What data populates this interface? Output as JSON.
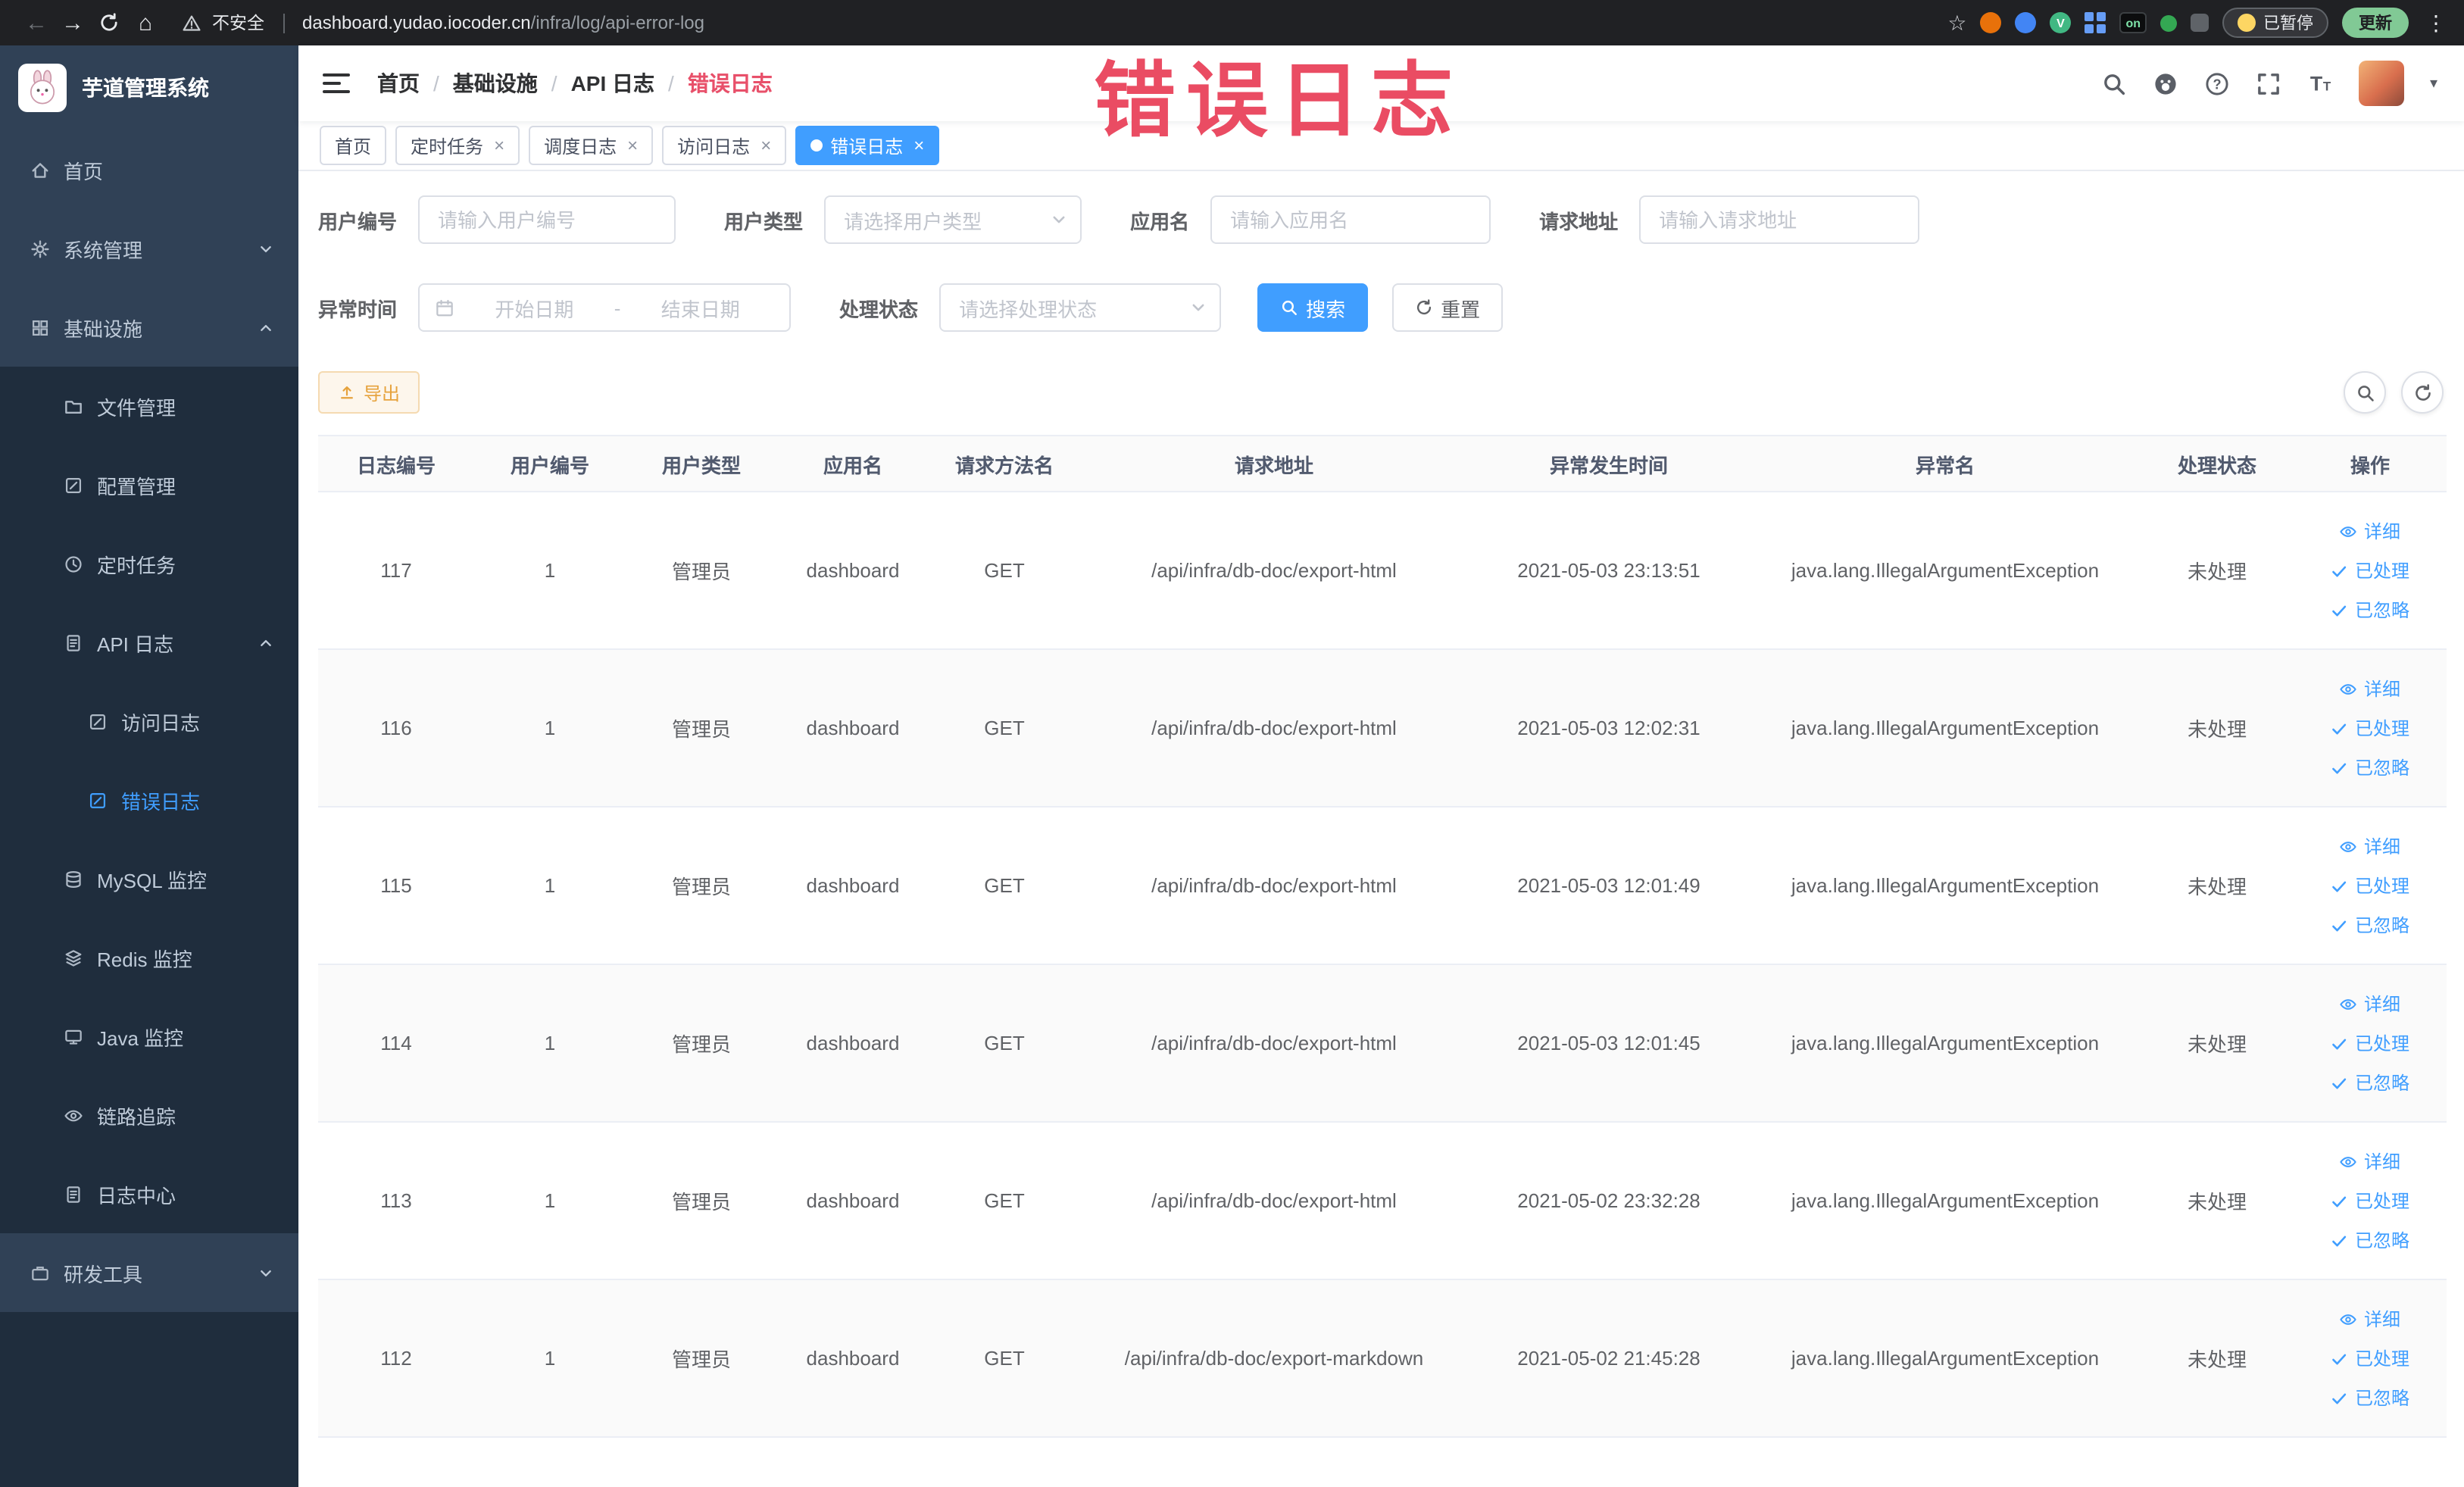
{
  "colors": {
    "accent": "#409eff",
    "annotation": "#ea4c63",
    "warning": "#e6a23c",
    "sidebar_bg": "#304156",
    "sidebar_sub_bg": "#1f2d3d"
  },
  "browser": {
    "security_label": "不安全",
    "url_domain": "dashboard.yudao.iocoder.cn",
    "url_path": "/infra/log/api-error-log",
    "extension_badge": "on",
    "extension_v_badge": "V",
    "paused_badge": "已暂停",
    "update_button": "更新"
  },
  "annotation": {
    "text": "错误日志"
  },
  "sidebar": {
    "app_title": "芋道管理系统",
    "items": [
      {
        "label": "首页"
      },
      {
        "label": "系统管理",
        "expanded": false
      },
      {
        "label": "基础设施",
        "expanded": true
      },
      {
        "label": "文件管理"
      },
      {
        "label": "配置管理"
      },
      {
        "label": "定时任务"
      },
      {
        "label": "API 日志",
        "expanded": true
      },
      {
        "label": "访问日志"
      },
      {
        "label": "错误日志",
        "active": true
      },
      {
        "label": "MySQL 监控"
      },
      {
        "label": "Redis 监控"
      },
      {
        "label": "Java 监控"
      },
      {
        "label": "链路追踪"
      },
      {
        "label": "日志中心"
      },
      {
        "label": "研发工具",
        "expanded": false
      }
    ]
  },
  "breadcrumb": {
    "items": [
      "首页",
      "基础设施",
      "API 日志",
      "错误日志"
    ]
  },
  "tabs": [
    {
      "label": "首页",
      "closable": false,
      "active": false
    },
    {
      "label": "定时任务",
      "closable": true,
      "active": false
    },
    {
      "label": "调度日志",
      "closable": true,
      "active": false
    },
    {
      "label": "访问日志",
      "closable": true,
      "active": false
    },
    {
      "label": "错误日志",
      "closable": true,
      "active": true
    }
  ],
  "filters": {
    "user_id_label": "用户编号",
    "user_id_placeholder": "请输入用户编号",
    "user_type_label": "用户类型",
    "user_type_placeholder": "请选择用户类型",
    "app_name_label": "应用名",
    "app_name_placeholder": "请输入应用名",
    "request_url_label": "请求地址",
    "request_url_placeholder": "请输入请求地址",
    "exception_time_label": "异常时间",
    "date_start_placeholder": "开始日期",
    "date_separator": "-",
    "date_end_placeholder": "结束日期",
    "status_label": "处理状态",
    "status_placeholder": "请选择处理状态",
    "search_button": "搜索",
    "reset_button": "重置"
  },
  "toolbar": {
    "export_button": "导出"
  },
  "icons": {
    "navbar": [
      "search-icon",
      "github-icon",
      "help-icon",
      "fullscreen-icon",
      "font-size-icon"
    ],
    "toolbar_right": [
      "search-toggle-icon",
      "refresh-icon"
    ],
    "row_actions": [
      "eye-icon",
      "check-icon",
      "check-icon"
    ]
  },
  "table": {
    "columns": [
      "日志编号",
      "用户编号",
      "用户类型",
      "应用名",
      "请求方法名",
      "请求地址",
      "异常发生时间",
      "异常名",
      "处理状态",
      "操作"
    ],
    "actions": {
      "detail": "详细",
      "processed": "已处理",
      "ignored": "已忽略"
    },
    "rows": [
      {
        "log_id": "117",
        "user_id": "1",
        "user_type": "管理员",
        "app_name": "dashboard",
        "method": "GET",
        "url": "/api/infra/db-doc/export-html",
        "time": "2021-05-03 23:13:51",
        "exception": "java.lang.IllegalArgumentException",
        "status": "未处理"
      },
      {
        "log_id": "116",
        "user_id": "1",
        "user_type": "管理员",
        "app_name": "dashboard",
        "method": "GET",
        "url": "/api/infra/db-doc/export-html",
        "time": "2021-05-03 12:02:31",
        "exception": "java.lang.IllegalArgumentException",
        "status": "未处理"
      },
      {
        "log_id": "115",
        "user_id": "1",
        "user_type": "管理员",
        "app_name": "dashboard",
        "method": "GET",
        "url": "/api/infra/db-doc/export-html",
        "time": "2021-05-03 12:01:49",
        "exception": "java.lang.IllegalArgumentException",
        "status": "未处理"
      },
      {
        "log_id": "114",
        "user_id": "1",
        "user_type": "管理员",
        "app_name": "dashboard",
        "method": "GET",
        "url": "/api/infra/db-doc/export-html",
        "time": "2021-05-03 12:01:45",
        "exception": "java.lang.IllegalArgumentException",
        "status": "未处理"
      },
      {
        "log_id": "113",
        "user_id": "1",
        "user_type": "管理员",
        "app_name": "dashboard",
        "method": "GET",
        "url": "/api/infra/db-doc/export-html",
        "time": "2021-05-02 23:32:28",
        "exception": "java.lang.IllegalArgumentException",
        "status": "未处理"
      },
      {
        "log_id": "112",
        "user_id": "1",
        "user_type": "管理员",
        "app_name": "dashboard",
        "method": "GET",
        "url": "/api/infra/db-doc/export-markdown",
        "time": "2021-05-02 21:45:28",
        "exception": "java.lang.IllegalArgumentException",
        "status": "未处理"
      }
    ]
  }
}
